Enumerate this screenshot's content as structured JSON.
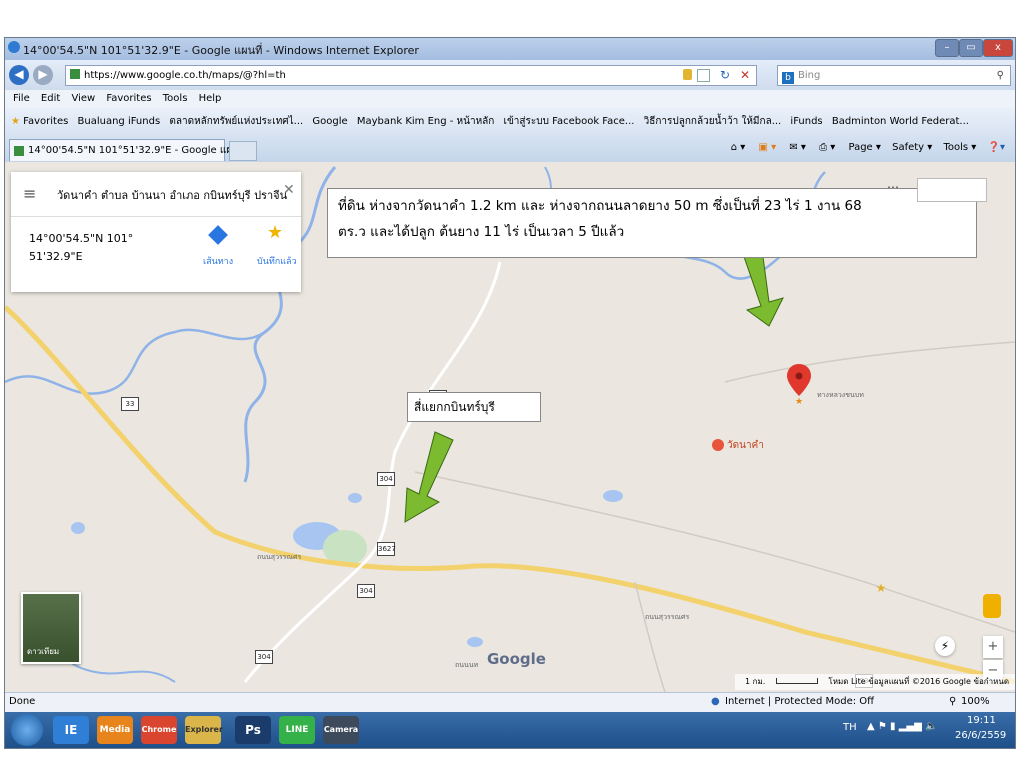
{
  "window": {
    "title": "14°00'54.5\"N 101°51'32.9\"E - Google แผนที่ - Windows Internet Explorer",
    "min": "–",
    "max": "▭",
    "close": "x"
  },
  "address": {
    "url": "https://www.google.co.th/maps/@?hl=th",
    "search_placeholder": "Bing"
  },
  "menu": [
    "File",
    "Edit",
    "View",
    "Favorites",
    "Tools",
    "Help"
  ],
  "favorites": {
    "label": "Favorites",
    "items": [
      "Bualuang iFunds",
      "ตลาดหลักทรัพย์แห่งประเทศไ...",
      "Google",
      "Maybank Kim Eng - หน้าหลัก",
      "เข้าสู่ระบบ Facebook Face...",
      "วิธีการปลูกกล้วยน้ำว้า ให้มีกล...",
      "iFunds",
      "Badminton World Federat..."
    ]
  },
  "tab": {
    "label": "14°00'54.5\"N 101°51'32.9\"E - Google แผนที่"
  },
  "commands": [
    "Page ▾",
    "Safety ▾",
    "Tools ▾"
  ],
  "map": {
    "search_text": "วัดนาคำ ตำบล บ้านนา อำเภอ กบินทร์บุรี ปราจีนบุรี",
    "coords_line1": "14°00'54.5\"N 101°",
    "coords_line2": "51'32.9\"E",
    "directions_label": "เส้นทาง",
    "saved_label": "บันทึกแล้ว",
    "annotation_line1": "ที่ดิน ห่างจากวัดนาคำ  1.2 km และ ห่างจากถนนลาดยาง 50 m  ซึ่งเป็นที่ 23 ไร่ 1 งาน 68",
    "annotation_line2": "ตร.ว และได้ปลูก ต้นยาง 11 ไร่ เป็นเวลา 5 ปีแล้ว",
    "intersection_label": "สี่แยกกบินทร์บุรี",
    "temple_label": "วัดนาคำ",
    "satellite_label": "ดาวเทียม",
    "google_logo": "Google",
    "scale_text": "1 กม.",
    "footer_text": "โหมด Lite   ข้อมูลแผนที่ ©2016 Google   ข้อกำหนด",
    "routes": [
      "304",
      "33",
      "304",
      "3627",
      "304",
      "304",
      "33"
    ],
    "road_names": [
      "ถนนสุวรรณศร",
      "ถนนสุวรรณศร",
      "ทางหลวงชนบท",
      "ถนนนท"
    ]
  },
  "status": {
    "left": "Done",
    "zone": "Internet | Protected Mode: Off",
    "zoom": "100%"
  },
  "taskbar": {
    "lang": "TH",
    "time": "19:11",
    "date": "26/6/2559",
    "apps": [
      "IE",
      "Media",
      "Chrome",
      "Explorer",
      "Ps",
      "LINE",
      "Camera"
    ]
  }
}
